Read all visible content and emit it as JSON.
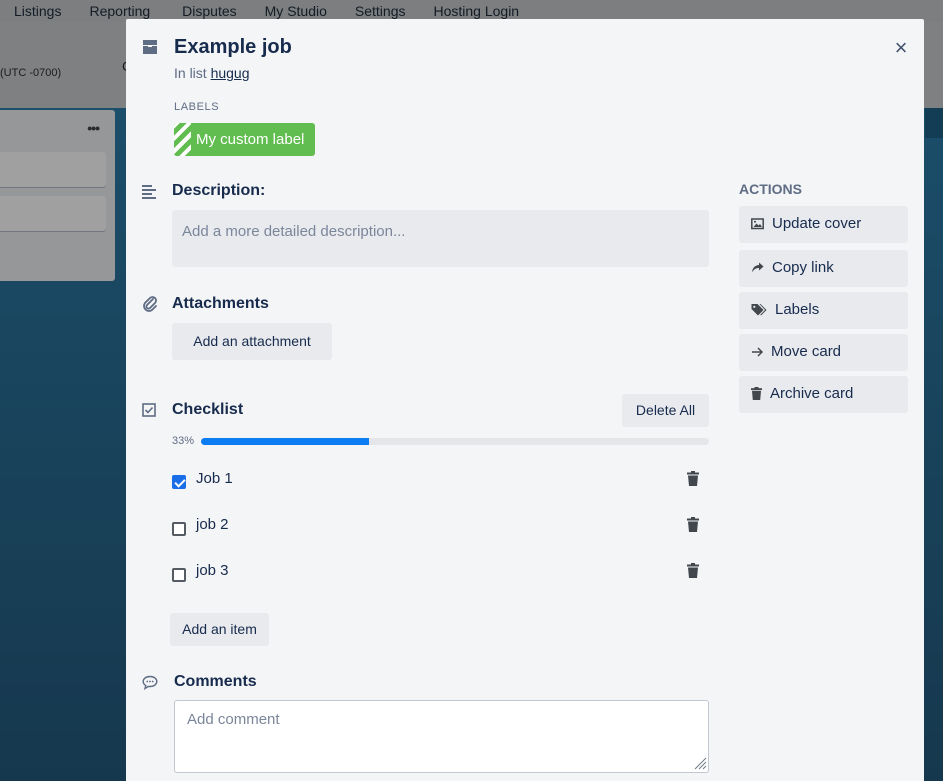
{
  "background": {
    "nav": [
      "Listings",
      "Reporting",
      "Disputes",
      "My Studio",
      "Settings",
      "Hosting Login"
    ],
    "timezone": "(UTC -0700)",
    "stub_text": "C",
    "list_menu": "•••"
  },
  "card": {
    "title": "Example job",
    "in_list_prefix": "In list",
    "list_name": "hugug",
    "close_glyph": "×"
  },
  "labels": {
    "heading": "LABELS",
    "items": [
      {
        "text": "My custom label",
        "color": "#61bd4f"
      }
    ]
  },
  "description": {
    "title": "Description:",
    "placeholder": "Add a more detailed description..."
  },
  "attachments": {
    "title": "Attachments",
    "add_button": "Add an attachment"
  },
  "checklist": {
    "title": "Checklist",
    "delete_all": "Delete All",
    "progress_label": "33%",
    "progress_fraction": 0.33,
    "progress_color": "#0c7cf2",
    "items": [
      {
        "text": "Job 1",
        "checked": true
      },
      {
        "text": "job 2",
        "checked": false
      },
      {
        "text": "job 3",
        "checked": false
      }
    ],
    "add_item": "Add an item"
  },
  "comments": {
    "title": "Comments",
    "placeholder": "Add comment"
  },
  "actions": {
    "heading": "ACTIONS",
    "buttons": [
      {
        "label": "Update cover",
        "icon": "image-icon"
      },
      {
        "label": "Copy link",
        "icon": "share-arrow-icon"
      },
      {
        "label": "Labels",
        "icon": "tags-icon"
      },
      {
        "label": "Move card",
        "icon": "arrow-right-icon"
      },
      {
        "label": "Archive card",
        "icon": "trash-icon"
      }
    ]
  }
}
